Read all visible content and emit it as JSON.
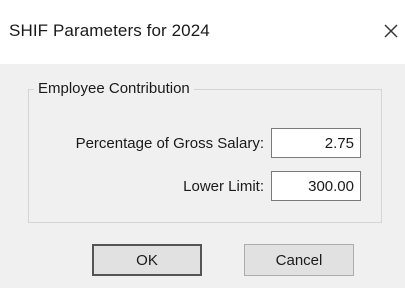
{
  "window": {
    "title": "SHIF Parameters for 2024",
    "close_icon": "close-icon"
  },
  "group": {
    "legend": "Employee Contribution",
    "percentage_label": "Percentage of Gross Salary:",
    "percentage_value": "2.75",
    "lower_limit_label": "Lower Limit:",
    "lower_limit_value": "300.00"
  },
  "buttons": {
    "ok_label": "OK",
    "cancel_label": "Cancel"
  },
  "colors": {
    "title_background": "#ffffff",
    "dialog_background": "#f0f0f0",
    "button_face": "#e1e1e1"
  }
}
